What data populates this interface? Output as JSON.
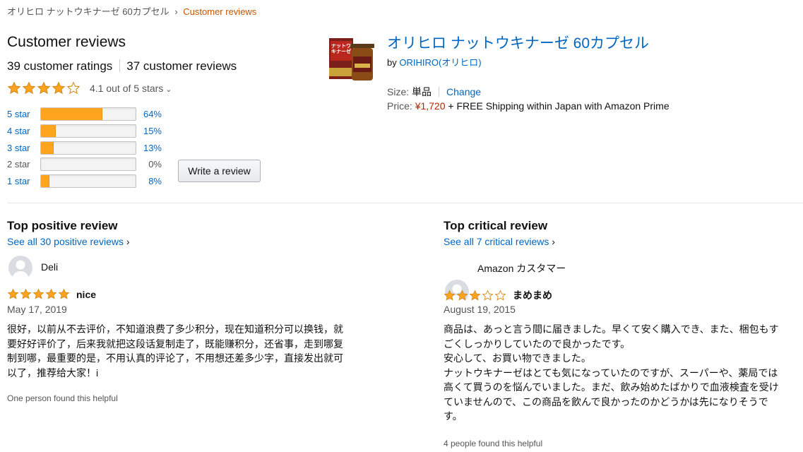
{
  "breadcrumb": {
    "product": "オリヒロ ナットウキナーゼ 60カプセル",
    "separator": "›",
    "current": "Customer reviews"
  },
  "summary": {
    "title": "Customer reviews",
    "ratings_count": "39 customer ratings",
    "reviews_count": "37 customer reviews",
    "rating_text": "4.1 out of 5 stars",
    "rating_value": 4.1,
    "caret": "⌄"
  },
  "histogram": [
    {
      "label": "5 star",
      "percent": "64%",
      "value": 64,
      "linked": true
    },
    {
      "label": "4 star",
      "percent": "15%",
      "value": 15,
      "linked": true
    },
    {
      "label": "3 star",
      "percent": "13%",
      "value": 13,
      "linked": true
    },
    {
      "label": "2 star",
      "percent": "0%",
      "value": 0,
      "linked": false
    },
    {
      "label": "1 star",
      "percent": "8%",
      "value": 8,
      "linked": true
    }
  ],
  "write_review_label": "Write a review",
  "product": {
    "title": "オリヒロ ナットウキナーゼ 60カプセル",
    "by_prefix": "by",
    "brand": "ORIHIRO(オリヒロ)",
    "size_label": "Size:",
    "size_value": "単品",
    "change_label": "Change",
    "price_label": "Price:",
    "price": "¥1,720",
    "shipping": "+ FREE Shipping within Japan with Amazon Prime",
    "box_text": "ナットウキナーゼ"
  },
  "positive": {
    "heading": "Top positive review",
    "see_all": "See all 30 positive reviews",
    "chevron": "›",
    "reviewer": "Deli",
    "stars": 5,
    "title": "nice",
    "date": "May 17, 2019",
    "body_lines": [
      "很好，以前从不去评价，不知道浪费了多少积分，现在知道积分可以换钱，就",
      "要好好评价了，后来我就把这段话复制走了，既能赚积分，还省事，走到哪复",
      "制到哪，最重要的是，不用认真的评论了，不用想还差多少字，直接发出就可",
      "以了，推荐给大家！i"
    ],
    "helpful": "One person found this helpful"
  },
  "critical": {
    "heading": "Top critical review",
    "see_all": "See all 7 critical reviews",
    "chevron": "›",
    "reviewer": "Amazon カスタマー",
    "stars": 3,
    "title": "まめまめ",
    "date": "August 19, 2015",
    "body_lines": [
      "商品は、あっと言う間に届きました。早くて安く購入でき、また、梱包もす",
      "ごくしっかりしていたので良かったです。",
      "安心して、お買い物できました。",
      "ナットウキナーゼはとても気になっていたのですが、スーパーや、薬局では",
      "高くて買うのを悩んでいました。まだ、飲み始めたばかりで血液検査を受け",
      "ていませんので、この商品を飲んで良かったのかどうかは先になりそうで",
      "す。"
    ],
    "helpful": "4 people found this helpful"
  },
  "colors": {
    "link": "#0066c0",
    "star": "#ffa41c",
    "price": "#b12704",
    "breadcrumb_current": "#c45500"
  },
  "icons": {
    "star": "star-icon",
    "avatar": "user-avatar-icon",
    "chevron": "chevron-right-icon"
  }
}
